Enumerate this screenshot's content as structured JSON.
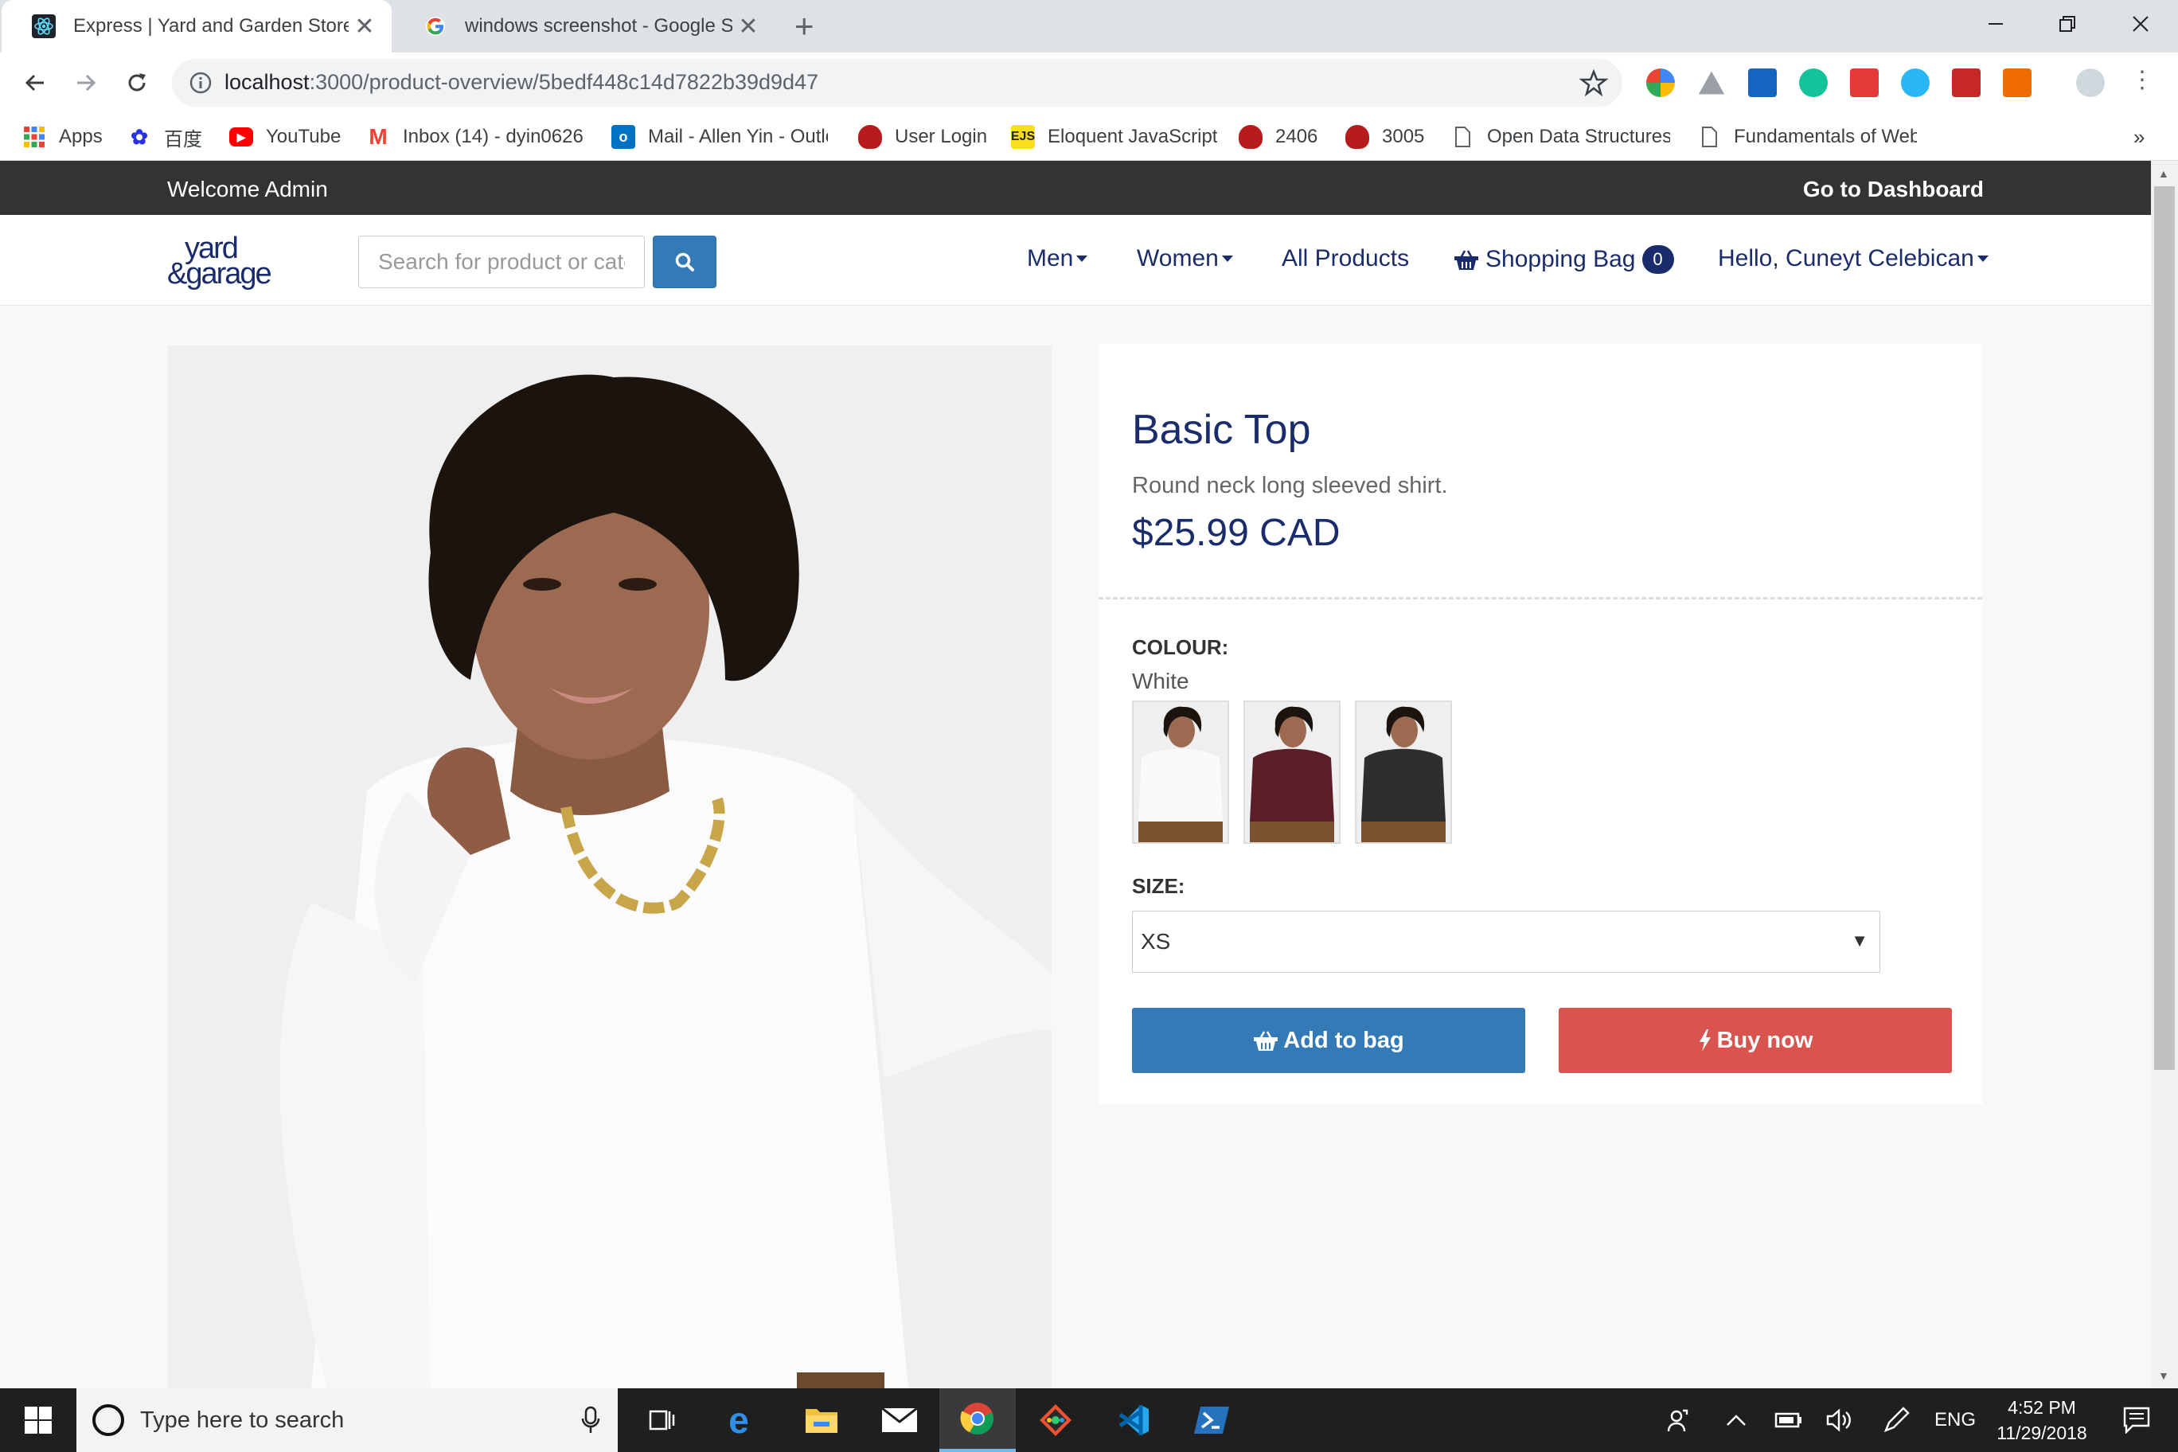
{
  "browser": {
    "tabs": [
      {
        "title": "Express | Yard and Garden Store",
        "active": true
      },
      {
        "title": "windows screenshot - Google Search",
        "active": false
      }
    ],
    "url_host": "localhost",
    "url_path": ":3000/product-overview/5bedf448c14d7822b39d9d47",
    "bookmarks": [
      "Apps",
      "百度",
      "YouTube",
      "Inbox (14) - dyin0626",
      "Mail - Allen Yin - Outlook",
      "User Login",
      "Eloquent JavaScript",
      "2406",
      "3005",
      "Open Data Structures",
      "Fundamentals of Web"
    ],
    "bookmarks_overflow": "»"
  },
  "site": {
    "admin_bar": {
      "welcome": "Welcome Admin",
      "dashboard": "Go to Dashboard"
    },
    "search": {
      "placeholder": "Search for product or category"
    },
    "nav": {
      "men": "Men",
      "women": "Women",
      "all_products": "All Products",
      "bag": "Shopping Bag",
      "bag_count": "0",
      "user": "Hello, Cuneyt Celebican"
    }
  },
  "product": {
    "name": "Basic Top",
    "description": "Round neck long sleeved shirt.",
    "price": "$25.99 CAD",
    "colour_label": "COLOUR:",
    "colour_value": "White",
    "swatches": [
      "white",
      "burgundy",
      "charcoal"
    ],
    "size_label": "SIZE:",
    "size_value": "XS",
    "add_to_bag": "Add to bag",
    "buy_now": "Buy now"
  },
  "taskbar": {
    "search_placeholder": "Type here to search",
    "language": "ENG",
    "time": "4:52 PM",
    "date": "11/29/2018"
  },
  "colors": {
    "brand_navy": "#1a2c6b",
    "primary_blue": "#337ab7",
    "danger_red": "#d9534f",
    "admin_bar": "#333333"
  }
}
